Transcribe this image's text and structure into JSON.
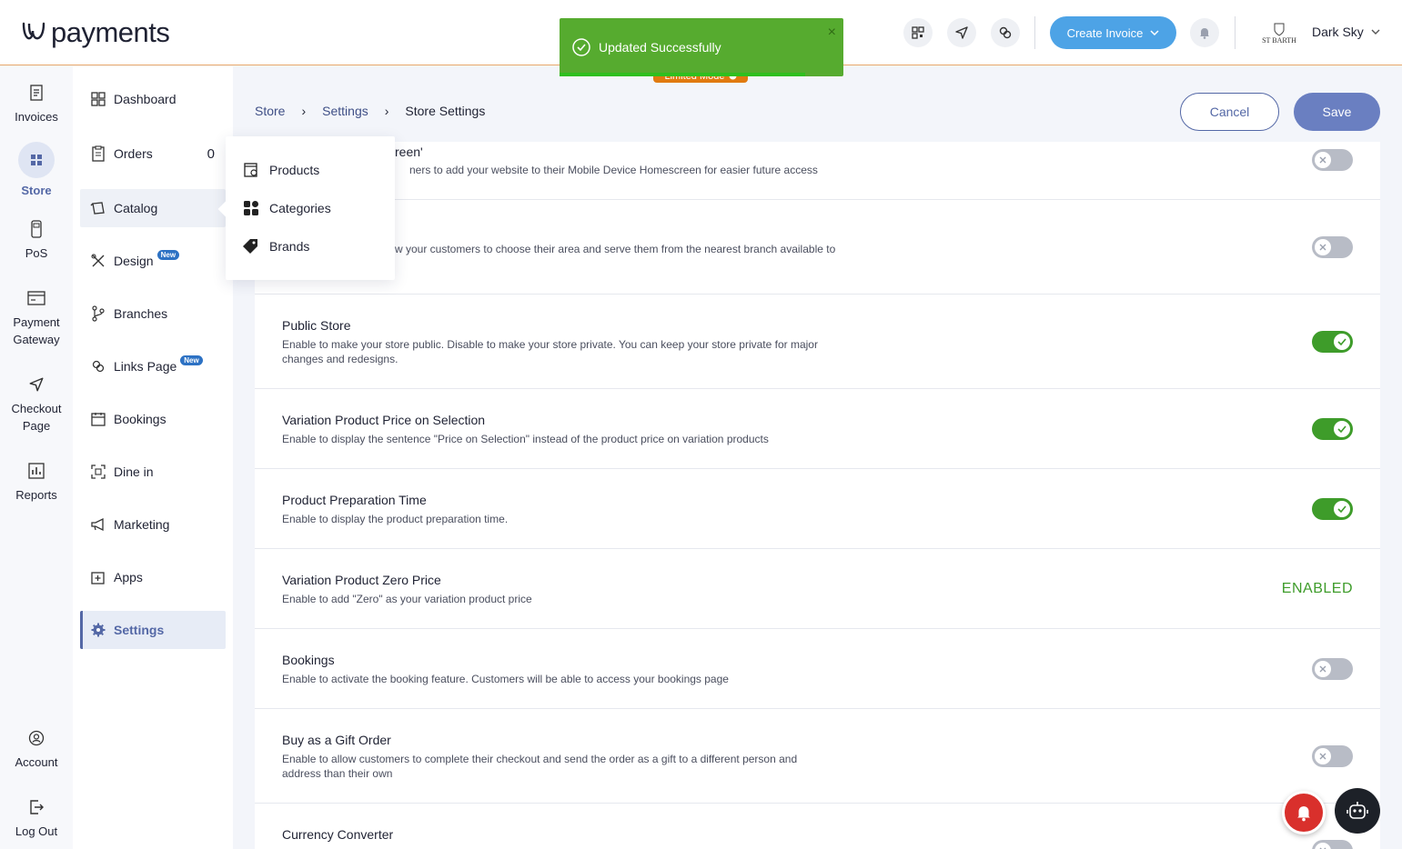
{
  "brand": {
    "logo_text": "payments"
  },
  "toast": {
    "message": "Updated Successfully",
    "close": "×",
    "color": "#56ab2f"
  },
  "limited_mode": {
    "label": "Limited Mode"
  },
  "header": {
    "create_invoice": "Create Invoice",
    "user_name": "Dark Sky",
    "avatar_text": "ST BARTH"
  },
  "rail": {
    "items": [
      {
        "label": "Invoices",
        "icon": "invoice-icon"
      },
      {
        "label": "Store",
        "icon": "store-icon",
        "active": true
      },
      {
        "label": "PoS",
        "icon": "pos-icon"
      },
      {
        "label": "Payment Gateway",
        "icon": "payment-gateway-icon"
      },
      {
        "label": "Checkout Page",
        "icon": "send-icon"
      },
      {
        "label": "Reports",
        "icon": "reports-icon"
      },
      {
        "label": "Account",
        "icon": "account-icon"
      },
      {
        "label": "Log Out",
        "icon": "logout-icon"
      }
    ]
  },
  "sidenav": {
    "items": [
      {
        "label": "Dashboard"
      },
      {
        "label": "Orders",
        "count": "0"
      },
      {
        "label": "Catalog"
      },
      {
        "label": "Design",
        "badge": "New"
      },
      {
        "label": "Branches"
      },
      {
        "label": "Links Page",
        "badge": "New"
      },
      {
        "label": "Bookings"
      },
      {
        "label": "Dine in"
      },
      {
        "label": "Marketing"
      },
      {
        "label": "Apps"
      },
      {
        "label": "Settings"
      }
    ]
  },
  "catalog_menu": {
    "items": [
      {
        "label": "Products"
      },
      {
        "label": "Categories"
      },
      {
        "label": "Brands"
      }
    ]
  },
  "breadcrumb": {
    "store": "Store",
    "settings": "Settings",
    "current": "Store Settings",
    "sep": "›"
  },
  "actions": {
    "cancel": "Cancel",
    "save": "Save"
  },
  "settings": [
    {
      "title": "creen'",
      "desc": "ners to add your website to their Mobile Device Homescreen for easier future access",
      "state": "off"
    },
    {
      "title": "",
      "desc": "w your customers to choose their area and serve them from the nearest branch available to",
      "state": "off"
    },
    {
      "title": "Public Store",
      "desc": "Enable to make your store public. Disable to make your store private. You can keep your store private for major changes and redesigns.",
      "state": "on"
    },
    {
      "title": "Variation Product Price on Selection",
      "desc": "Enable to display the sentence \"Price on Selection\" instead of the product price on variation products",
      "state": "on"
    },
    {
      "title": "Product Preparation Time",
      "desc": "Enable to display the product preparation time.",
      "state": "on"
    },
    {
      "title": "Variation Product Zero Price",
      "desc": "Enable to add \"Zero\" as your variation product price",
      "state": "text",
      "value": "ENABLED"
    },
    {
      "title": "Bookings",
      "desc": "Enable to activate the booking feature. Customers will be able to access your bookings page",
      "state": "off"
    },
    {
      "title": "Buy as a Gift Order",
      "desc": "Enable to allow customers to complete their checkout and send the order as a gift to a different person and address than their own",
      "state": "off"
    },
    {
      "title": "Currency Converter",
      "desc": "",
      "state": "off"
    }
  ],
  "colors": {
    "accent": "#5468a6",
    "toggle_on": "#3e9c2a",
    "toggle_off": "#b8bcc6",
    "create_invoice": "#4da3e6",
    "header_border": "#e8a76a"
  }
}
